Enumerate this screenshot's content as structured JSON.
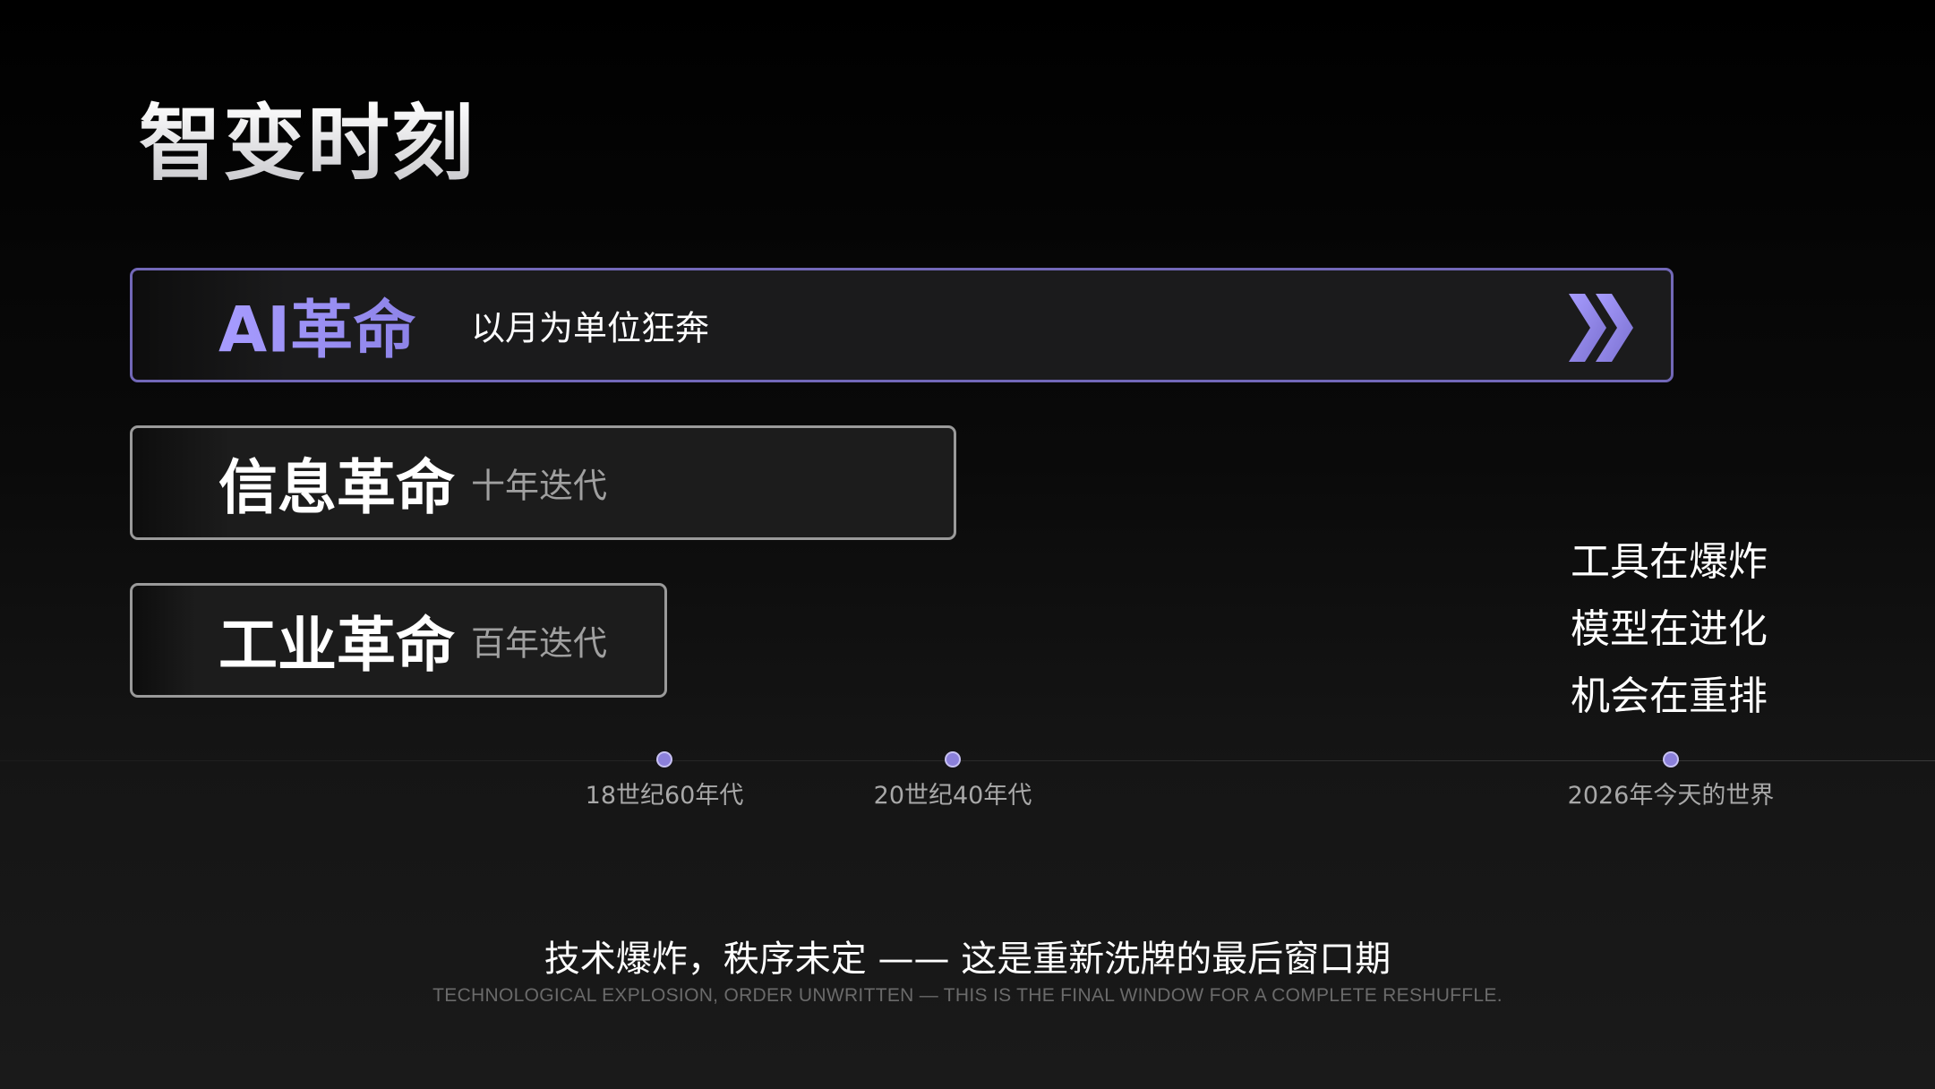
{
  "title": "智变时刻",
  "revolutions": [
    {
      "name": "AI革命",
      "subtitle": "以月为单位狂奔",
      "icon": "double-chevron-right-icon"
    },
    {
      "name": "信息革命",
      "subtitle": "十年迭代"
    },
    {
      "name": "工业革命",
      "subtitle": "百年迭代"
    }
  ],
  "tagline": [
    "工具在爆炸",
    "模型在进化",
    "机会在重排"
  ],
  "timeline": [
    {
      "label": "18世纪60年代"
    },
    {
      "label": "20世纪40年代"
    },
    {
      "label": "2026年今天的世界"
    }
  ],
  "footer": {
    "cn": "技术爆炸，秩序未定 —— 这是重新洗牌的最后窗口期",
    "en": "TECHNOLOGICAL EXPLOSION, ORDER UNWRITTEN — THIS IS THE FINAL WINDOW FOR A COMPLETE RESHUFFLE."
  },
  "colors": {
    "accent": "#8d83e8",
    "accent_light": "#a79cff",
    "background": "#0a0a0a",
    "bar_border": "#9a9a9a"
  }
}
